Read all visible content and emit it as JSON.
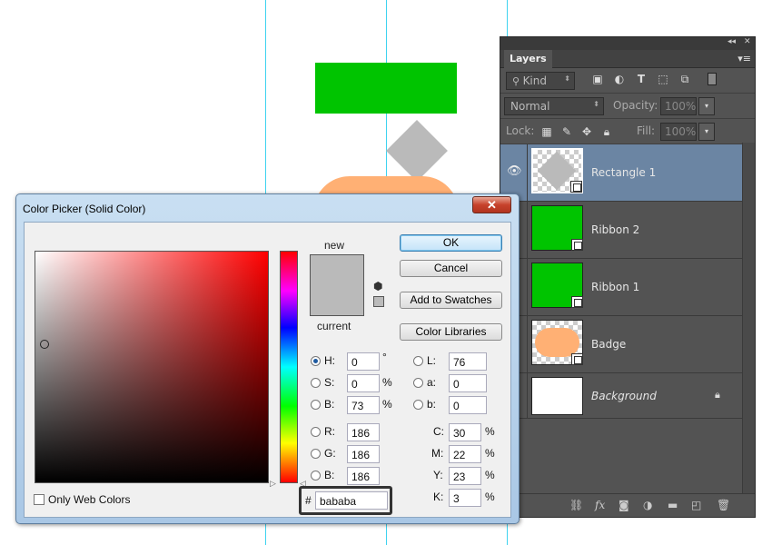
{
  "panel": {
    "tab_title": "Layers",
    "collapse_glyph": "◂◂",
    "close_glyph": "✕",
    "menu_glyph": "▾≡",
    "filter_kind": "Kind",
    "blend_mode": "Normal",
    "opacity_label": "Opacity:",
    "opacity_value": "100%",
    "lock_label": "Lock:",
    "fill_label": "Fill:",
    "fill_value": "100%",
    "layers": [
      {
        "name": "Rectangle 1",
        "selected": true,
        "visible": true
      },
      {
        "name": "Ribbon 2",
        "selected": false,
        "visible": false
      },
      {
        "name": "Ribbon 1",
        "selected": false,
        "visible": false
      },
      {
        "name": "Badge",
        "selected": false,
        "visible": false
      },
      {
        "name": "Background",
        "selected": false,
        "visible": false,
        "locked": true
      }
    ],
    "bottom_icons": [
      "link-icon",
      "fx-icon",
      "mask-icon",
      "adjustment-icon",
      "group-icon",
      "new-layer-icon",
      "trash-icon"
    ],
    "fx_glyph": "fx"
  },
  "dialog": {
    "title": "Color Picker (Solid Color)",
    "close_glyph": "✕",
    "new_label": "new",
    "current_label": "current",
    "ok_label": "OK",
    "cancel_label": "Cancel",
    "add_swatches_label": "Add to Swatches",
    "color_libraries_label": "Color Libraries",
    "only_web_colors": "Only Web Colors",
    "selected_color": "#bababa",
    "fields": {
      "H": {
        "label": "H:",
        "value": "0",
        "unit": "°"
      },
      "S": {
        "label": "S:",
        "value": "0",
        "unit": "%"
      },
      "Bv": {
        "label": "B:",
        "value": "73",
        "unit": "%"
      },
      "R": {
        "label": "R:",
        "value": "186"
      },
      "G": {
        "label": "G:",
        "value": "186"
      },
      "Bc": {
        "label": "B:",
        "value": "186"
      },
      "L": {
        "label": "L:",
        "value": "76"
      },
      "a": {
        "label": "a:",
        "value": "0"
      },
      "b": {
        "label": "b:",
        "value": "0"
      },
      "C": {
        "label": "C:",
        "value": "30",
        "unit": "%"
      },
      "M": {
        "label": "M:",
        "value": "22",
        "unit": "%"
      },
      "Y": {
        "label": "Y:",
        "value": "23",
        "unit": "%"
      },
      "K": {
        "label": "K:",
        "value": "3",
        "unit": "%"
      }
    },
    "hex_label": "#",
    "hex_value": "bababa"
  },
  "colors": {
    "ribbon_green": "#00c400",
    "badge_orange": "#ffb074",
    "diamond_gray": "#bababa",
    "guide_cyan": "#3fd3f0",
    "selected_layer": "#6b85a3"
  }
}
